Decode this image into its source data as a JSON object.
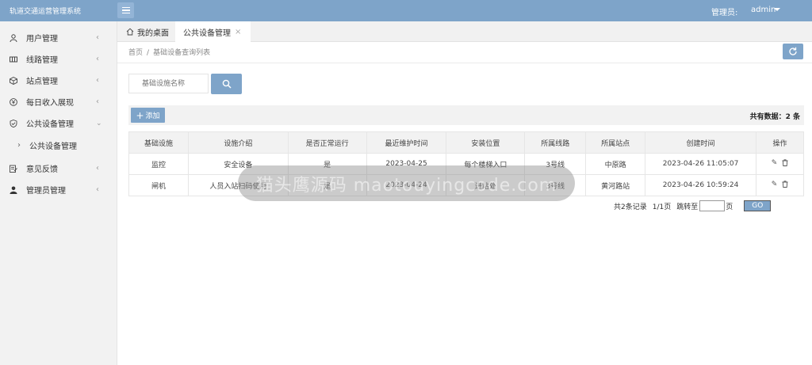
{
  "app": {
    "brand": "轨道交通运营管理系统",
    "admin_label": "管理员:",
    "admin_user": "admin"
  },
  "sidebar": {
    "items": [
      {
        "label": "用户管理",
        "icon": "user-icon"
      },
      {
        "label": "线路管理",
        "icon": "route-icon"
      },
      {
        "label": "站点管理",
        "icon": "cube-icon"
      },
      {
        "label": "每日收入展现",
        "icon": "yen-icon"
      },
      {
        "label": "公共设备管理",
        "icon": "shield-icon"
      },
      {
        "label": "意见反馈",
        "icon": "feedback-icon"
      },
      {
        "label": "管理员管理",
        "icon": "admin-icon"
      }
    ],
    "sub_item": "公共设备管理"
  },
  "tabs": {
    "home": "我的桌面",
    "active": "公共设备管理",
    "close": "×"
  },
  "breadcrumb": {
    "home": "首页",
    "sep": "/",
    "current": "基础设备查询列表"
  },
  "search": {
    "placeholder": "基础设施名称"
  },
  "toolbar": {
    "add_label": "添加",
    "total_text": "共有数据：2 条"
  },
  "table": {
    "headers": [
      "基础设施",
      "设施介绍",
      "是否正常运行",
      "最近维护时间",
      "安装位置",
      "所属线路",
      "所属站点",
      "创建时间",
      "操作"
    ],
    "rows": [
      [
        "监控",
        "安全设备",
        "是",
        "2023-04-25",
        "每个楼梯入口",
        "3号线",
        "中原路",
        "2023-04-26 11:05:07"
      ],
      [
        "闸机",
        "人员入站扫码使用",
        "是",
        "2023-04-24",
        "进站处",
        "3号线",
        "黄河路站",
        "2023-04-26 10:59:24"
      ]
    ]
  },
  "pager": {
    "summary": "共2条记录",
    "pages": "1/1页",
    "jump": "跳转至",
    "page_unit": "页",
    "go": "GO"
  },
  "watermark": {
    "text": "猫头鹰源码 maotouyingcode.com"
  },
  "colors": {
    "accent": "#7ea4c9",
    "sidebar_bg": "#f2f2f2"
  }
}
